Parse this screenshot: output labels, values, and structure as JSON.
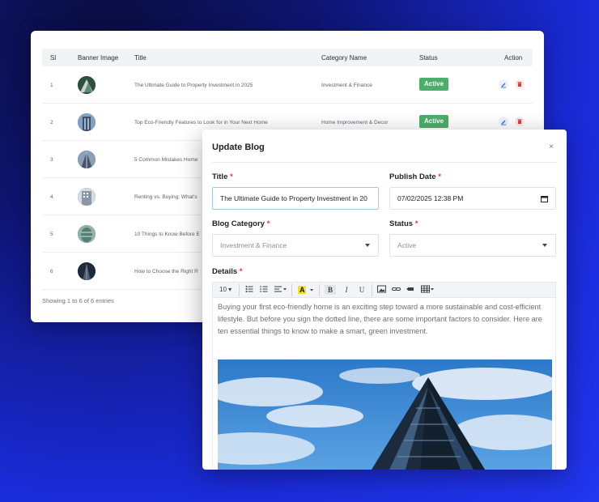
{
  "table": {
    "headers": [
      "Sl",
      "Banner Image",
      "Title",
      "Category Name",
      "Status",
      "Action"
    ],
    "rows": [
      {
        "sl": "1",
        "title": "The Ultimate Guide to Property Investment in 2025",
        "category": "Investment & Finance",
        "status": "Active"
      },
      {
        "sl": "2",
        "title": "Top Eco-Friendly Features to Look for in Your Next Home",
        "category": "Home Improvement & Decor",
        "status": "Active"
      },
      {
        "sl": "3",
        "title": "5 Common Mistakes Home",
        "category": "",
        "status": ""
      },
      {
        "sl": "4",
        "title": "Renting vs. Buying: What's",
        "category": "",
        "status": ""
      },
      {
        "sl": "5",
        "title": "10 Things to Know Before E",
        "category": "",
        "status": ""
      },
      {
        "sl": "6",
        "title": "How to Choose the Right R",
        "category": "",
        "status": ""
      }
    ],
    "footer": "Showing 1 to 6 of 6 entries"
  },
  "modal": {
    "title": "Update Blog",
    "close_glyph": "×",
    "fields": {
      "title_label": "Title",
      "title_value": "The Ultimate Guide to Property Investment in 20",
      "publish_label": "Publish Date",
      "publish_value": "07/02/2025 12:38 PM",
      "category_label": "Blog Category",
      "category_value": "Investment & Finance",
      "status_label": "Status",
      "status_value": "Active",
      "details_label": "Details",
      "required_mark": "*"
    },
    "toolbar": {
      "font_size": "10",
      "bold": "B",
      "italic": "I",
      "underline": "U"
    },
    "editor_text": "Buying your first eco-friendly home is an exciting step toward a more sustainable and cost-efficient lifestyle. But before you sign the dotted line, there are some important factors to consider. Here are ten essential things to know to make a smart, green investment."
  },
  "colors": {
    "status_active": "#4cae6a",
    "required": "#e53935",
    "edit_icon": "#2f6fe0",
    "delete_icon": "#e53935"
  }
}
